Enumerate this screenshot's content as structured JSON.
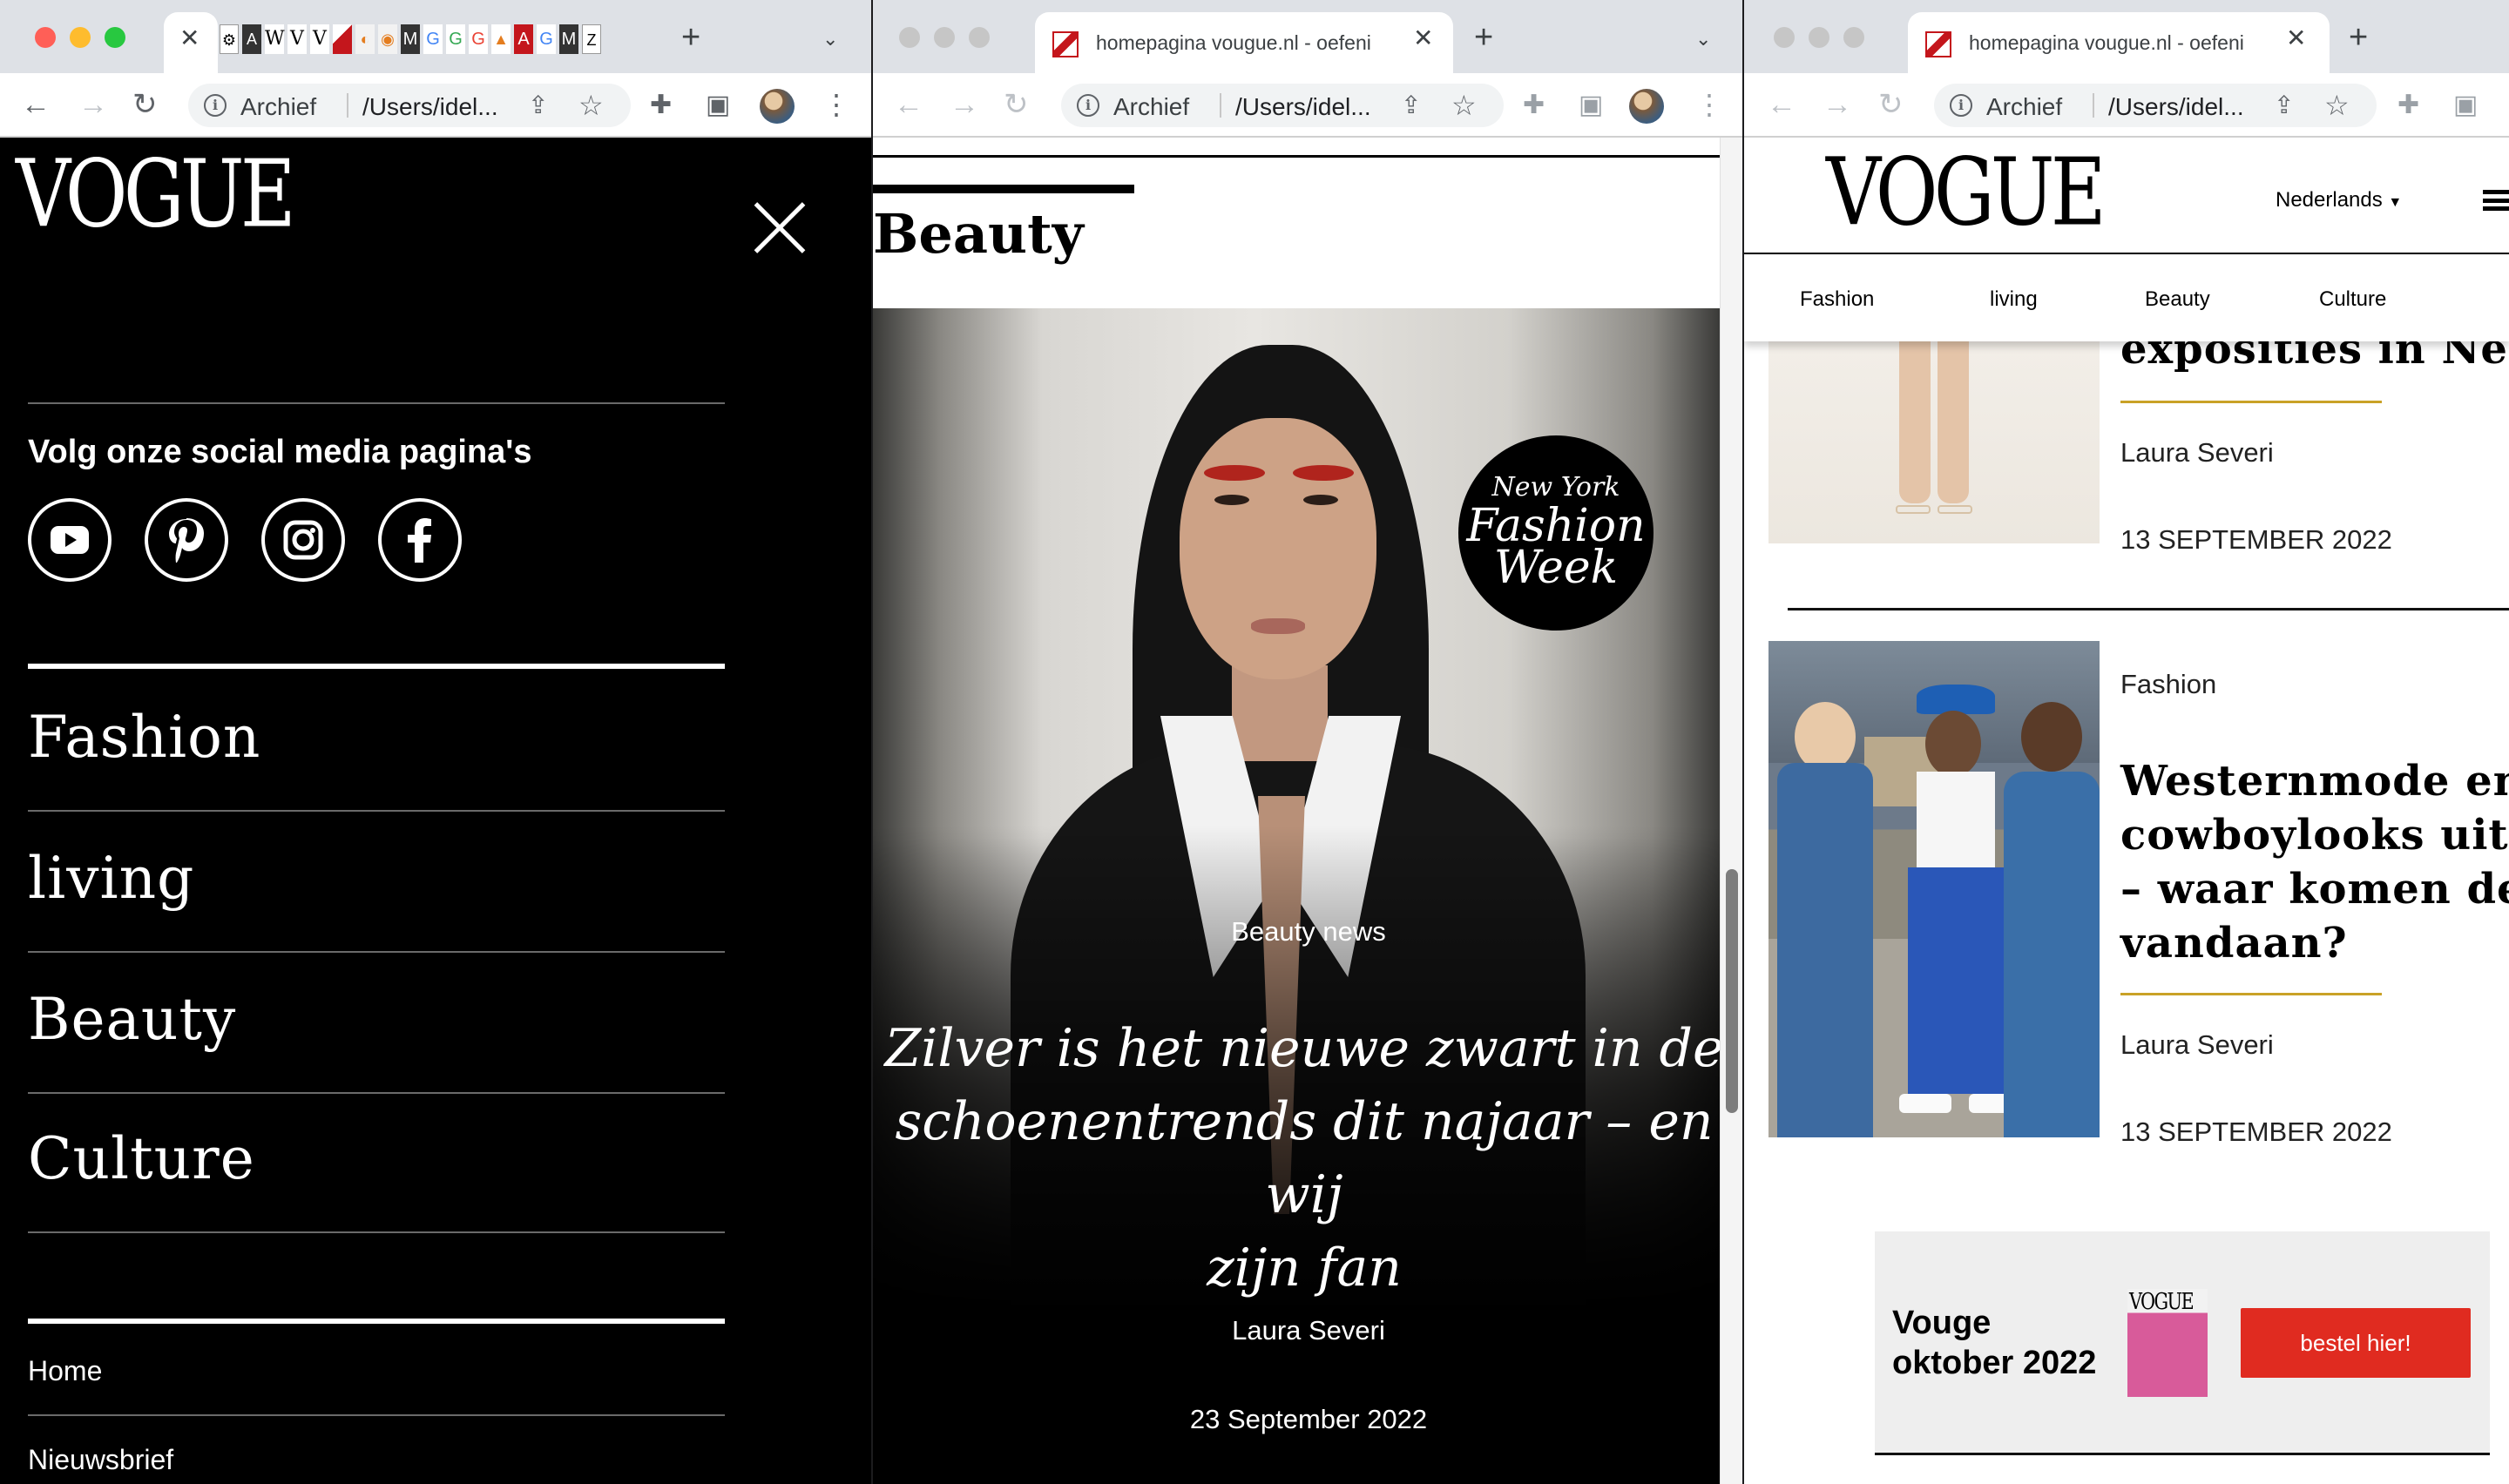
{
  "colors": {
    "accent_red": "#e02b20",
    "gold_rule": "#c9a227",
    "menu_bg": "#000000",
    "chrome_bg": "#dee1e6"
  },
  "browser": {
    "address_label": "Archief",
    "url": "/Users/idel...",
    "tab_title": "homepagina vougue.nl - oefeni",
    "tab_strip_glyphs": [
      "W",
      "V",
      "V",
      "M",
      "G",
      "G",
      "G",
      "A",
      "G",
      "M"
    ]
  },
  "menu": {
    "logo": "VOGUE",
    "social_title": "Volg onze social media pagina's",
    "social_icons": [
      "youtube-icon",
      "pinterest-icon",
      "instagram-icon",
      "facebook-icon"
    ],
    "items": [
      "Fashion",
      "living",
      "Beauty",
      "Culture"
    ],
    "footer_links": [
      "Home",
      "Nieuwsbrief"
    ]
  },
  "article": {
    "section": "Beauty",
    "badge": {
      "line1": "New York",
      "line2": "Fashion",
      "line3": "Week"
    },
    "category": "Beauty news",
    "title_lines": [
      "Zilver is het nieuwe zwart in de",
      "schoenentrends dit najaar – en wij",
      "zijn fan"
    ],
    "author": "Laura Severi",
    "date": "23 September 2022"
  },
  "page3": {
    "logo": "VOGUE",
    "language": "Nederlands",
    "nav": [
      "Fashion",
      "living",
      "Beauty",
      "Culture"
    ],
    "card1": {
      "title_tail": "exposities in Nederl",
      "author": "Laura Severi",
      "date": "13 SEPTEMBER 2022"
    },
    "card2": {
      "category": "Fashion",
      "title_lines": [
        "Westernmode en",
        "cowboylooks uitgel",
        "– waar komen de st",
        "vandaan?"
      ],
      "author": "Laura Severi",
      "date": "13 SEPTEMBER 2022"
    },
    "promo": {
      "line1": "Vouge",
      "line2": "oktober 2022",
      "cover_logo": "VOGUE",
      "button": "bestel hier!"
    }
  }
}
